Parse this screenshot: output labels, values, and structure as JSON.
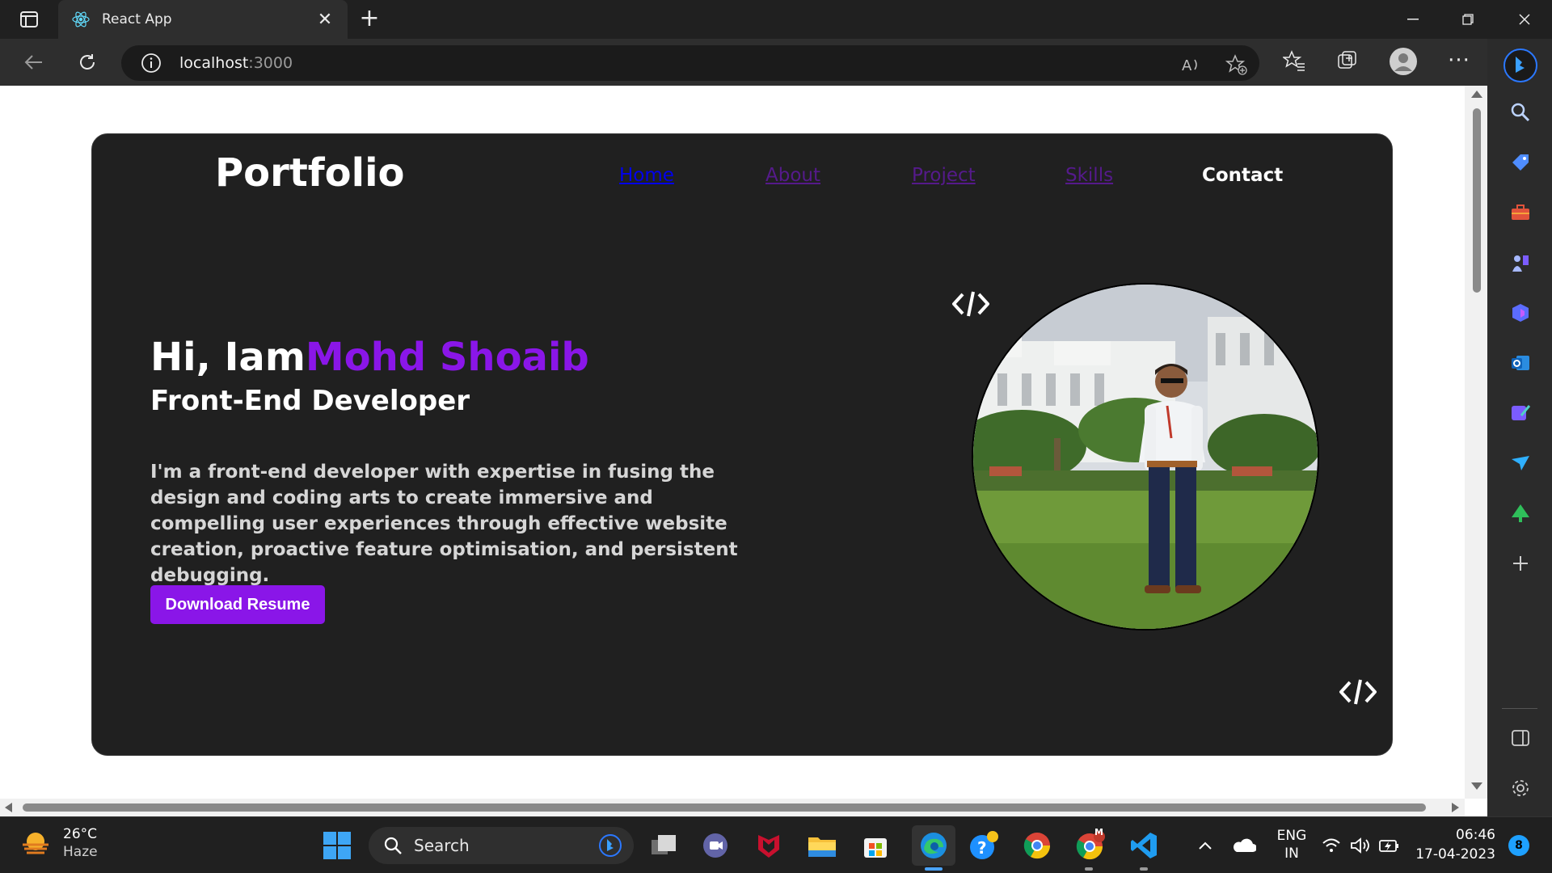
{
  "browser": {
    "tab_title": "React App",
    "url_host": "localhost",
    "url_port": ":3000"
  },
  "portfolio": {
    "logo": "Portfolio",
    "nav": {
      "home": "Home",
      "about": "About",
      "project": "Project",
      "skills": "Skills",
      "contact": "Contact"
    },
    "greeting": "Hi, Iam",
    "name": "Mohd Shoaib",
    "role": "Front-End Developer",
    "description": "I'm a front-end developer with expertise in fusing the design and coding arts to create immersive and compelling user experiences through effective website creation, proactive feature optimisation, and persistent debugging.",
    "resume_button": "Download Resume",
    "colors": {
      "accent": "#8a16e8",
      "card_bg": "#202020"
    }
  },
  "taskbar": {
    "weather_temp": "26°C",
    "weather_condition": "Haze",
    "search_label": "Search",
    "language": "ENG",
    "region": "IN",
    "time": "06:46",
    "date": "17-04-2023",
    "notification_count": "8",
    "chrome_badge": "M"
  }
}
